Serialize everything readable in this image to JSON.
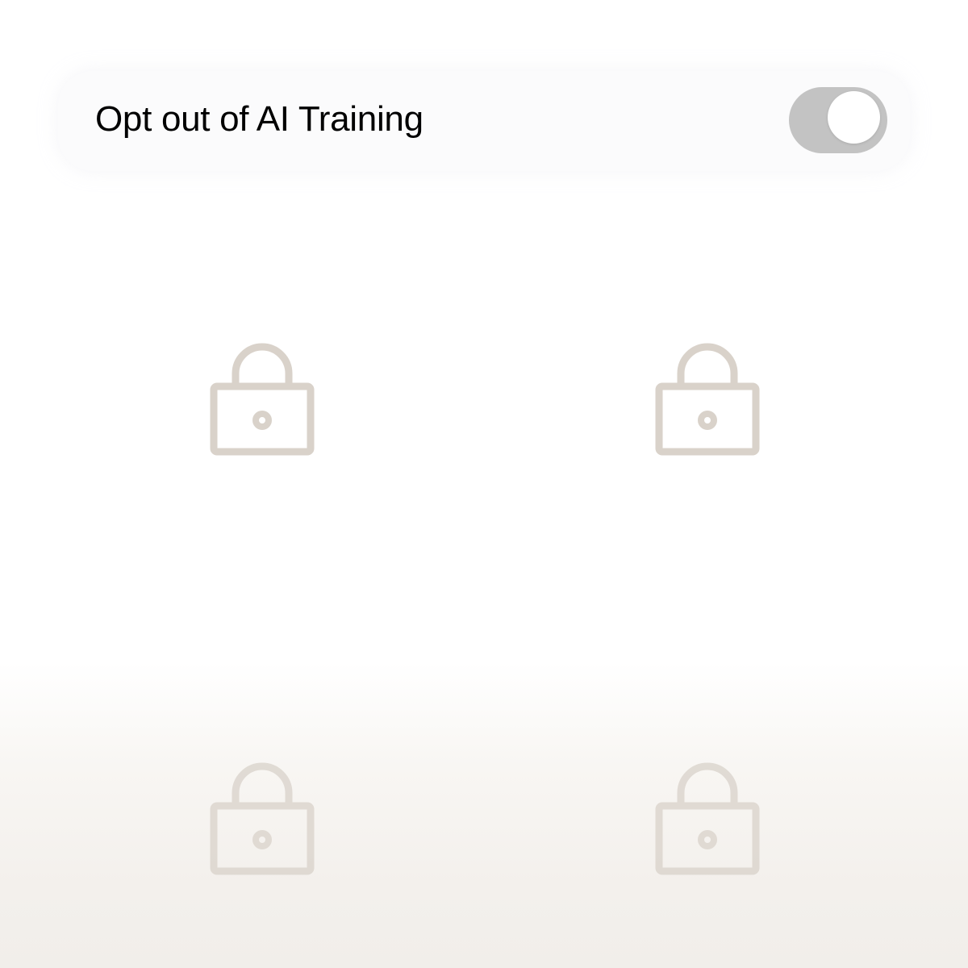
{
  "setting": {
    "label": "Opt out of AI Training",
    "toggle_on": false
  },
  "colors": {
    "lock_stroke": "#d9d2ca",
    "toggle_track": "#c3c3c3",
    "toggle_knob": "#ffffff"
  },
  "icons": {
    "lock": "lock-icon"
  }
}
